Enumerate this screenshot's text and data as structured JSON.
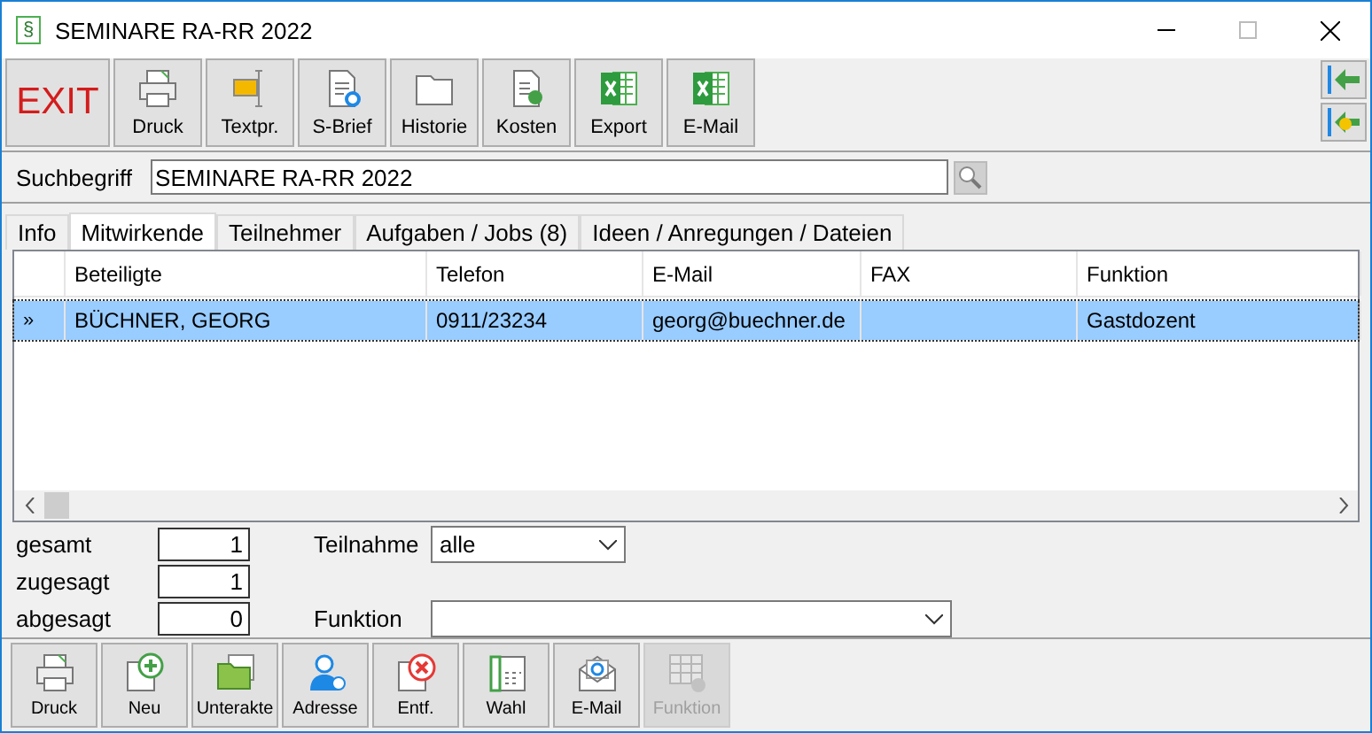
{
  "window": {
    "title": "SEMINARE RA-RR 2022",
    "icon": "§"
  },
  "toolbar": [
    {
      "label": "EXIT",
      "kind": "exit"
    },
    {
      "label": "Druck",
      "kind": "print"
    },
    {
      "label": "Textpr.",
      "kind": "text"
    },
    {
      "label": "S-Brief",
      "kind": "letter"
    },
    {
      "label": "Historie",
      "kind": "folder"
    },
    {
      "label": "Kosten",
      "kind": "costs"
    },
    {
      "label": "Export",
      "kind": "excel"
    },
    {
      "label": "E-Mail",
      "kind": "excel"
    }
  ],
  "search": {
    "label": "Suchbegriff",
    "value": "SEMINARE RA-RR 2022"
  },
  "tabs": [
    {
      "label": "Info",
      "selected": false
    },
    {
      "label": "Mitwirkende",
      "selected": true
    },
    {
      "label": "Teilnehmer",
      "selected": false
    },
    {
      "label": "Aufgaben / Jobs (8)",
      "selected": false
    },
    {
      "label": "Ideen / Anregungen / Dateien",
      "selected": false
    }
  ],
  "table": {
    "columns": [
      "Beteiligte",
      "Telefon",
      "E-Mail",
      "FAX",
      "Funktion"
    ],
    "rows": [
      {
        "marker": "»",
        "selected": true,
        "cells": [
          "BÜCHNER, GEORG",
          "0911/23234",
          "georg@buechner.de",
          "",
          "Gastdozent"
        ]
      }
    ]
  },
  "counts": [
    {
      "label": "gesamt",
      "value": "1"
    },
    {
      "label": "zugesagt",
      "value": "1"
    },
    {
      "label": "abgesagt",
      "value": "0"
    }
  ],
  "filters": [
    {
      "label": "Teilnahme",
      "value": "alle"
    },
    {
      "label": "Funktion"
    }
  ],
  "bottom_toolbar": [
    {
      "label": "Druck",
      "kind": "print",
      "disabled": false
    },
    {
      "label": "Neu",
      "kind": "new",
      "disabled": false
    },
    {
      "label": "Unterakte",
      "kind": "subfolder",
      "disabled": false
    },
    {
      "label": "Adresse",
      "kind": "person",
      "disabled": false
    },
    {
      "label": "Entf.",
      "kind": "delete",
      "disabled": false
    },
    {
      "label": "Wahl",
      "kind": "phone",
      "disabled": false
    },
    {
      "label": "E-Mail",
      "kind": "mail",
      "disabled": false
    },
    {
      "label": "Funktion",
      "kind": "grid",
      "disabled": true
    }
  ]
}
